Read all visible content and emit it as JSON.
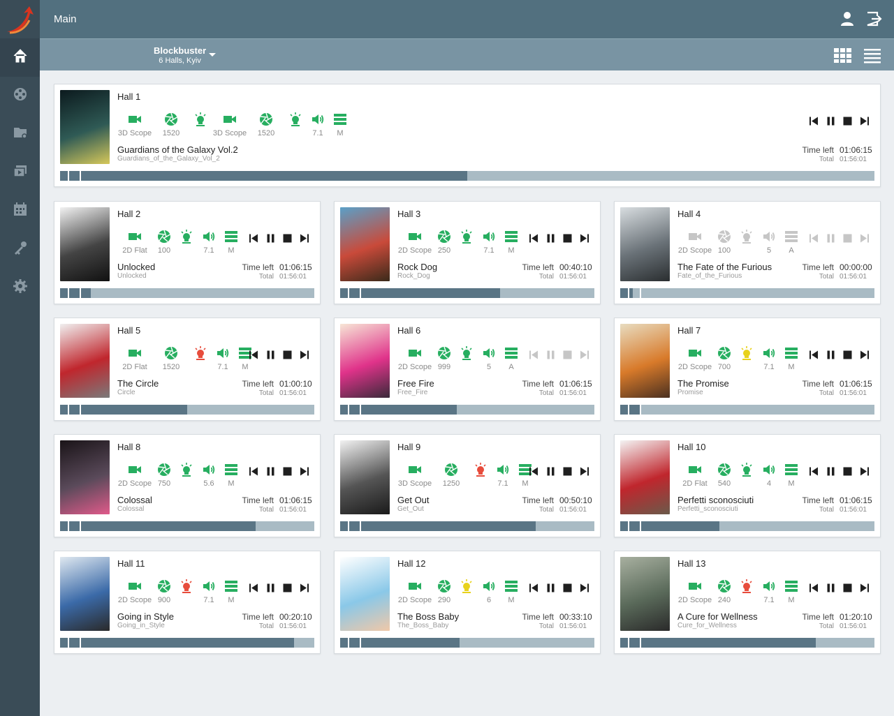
{
  "header": {
    "title": "Main"
  },
  "cinema": {
    "name": "Blockbuster",
    "location": "6 Halls, Kyiv"
  },
  "labels": {
    "time_left": "Time left",
    "total": "Total"
  },
  "colors": {
    "ok": "#27ae60",
    "warn": "#e8d21c",
    "err": "#e74c3c",
    "off": "#c6c6c6",
    "bar": "#a9bbc4",
    "fill": "#5a7585"
  },
  "nav": [
    {
      "icon": "home-icon",
      "active": true
    },
    {
      "icon": "film-reel-icon"
    },
    {
      "icon": "folder-settings-icon"
    },
    {
      "icon": "playlist-icon"
    },
    {
      "icon": "calendar-icon"
    },
    {
      "icon": "key-icon"
    },
    {
      "icon": "settings-gear-icon"
    }
  ],
  "halls": [
    {
      "name": "Hall 1",
      "movie": "Guardians of the Galaxy Vol.2",
      "file": "Guardians_of_the_Galaxy_Vol_2",
      "time_left": "01:06:15",
      "total": "01:56:01",
      "progress": 0.5,
      "active": true,
      "layout": "wide",
      "poster": [
        "#0c1a1e",
        "#2f5a55",
        "#d6c85a"
      ],
      "equip": [
        {
          "type": "projector",
          "label": "3D Scope",
          "status": "ok"
        },
        {
          "type": "lens",
          "label": "1520",
          "status": "ok"
        },
        {
          "type": "lamp",
          "label": "",
          "status": "ok"
        },
        {
          "type": "projector",
          "label": "3D Scope",
          "status": "ok"
        },
        {
          "type": "lens",
          "label": "1520",
          "status": "ok"
        },
        {
          "type": "lamp",
          "label": "",
          "status": "ok"
        },
        {
          "type": "sound",
          "label": "7.1",
          "status": "ok"
        },
        {
          "type": "list",
          "label": "M",
          "status": "ok"
        }
      ]
    },
    {
      "name": "Hall  2",
      "movie": "Unlocked",
      "file": "Unlocked",
      "time_left": "01:06:15",
      "total": "01:56:01",
      "progress": 0.12,
      "active": true,
      "poster": [
        "#f2f2f2",
        "#444",
        "#111"
      ],
      "equip": [
        {
          "type": "projector",
          "label": "2D Flat",
          "status": "ok"
        },
        {
          "type": "lens",
          "label": "100",
          "status": "ok"
        },
        {
          "type": "lamp",
          "label": "",
          "status": "ok"
        },
        {
          "type": "sound",
          "label": "7.1",
          "status": "ok"
        },
        {
          "type": "list",
          "label": "M",
          "status": "ok"
        }
      ]
    },
    {
      "name": "Hall 3",
      "movie": "Rock Dog",
      "file": "Rock_Dog",
      "time_left": "00:40:10",
      "total": "01:56:01",
      "progress": 0.63,
      "active": true,
      "poster": [
        "#5aa0c8",
        "#c94a3a",
        "#3a2a1a"
      ],
      "equip": [
        {
          "type": "projector",
          "label": "2D Scope",
          "status": "ok"
        },
        {
          "type": "lens",
          "label": "250",
          "status": "ok"
        },
        {
          "type": "lamp",
          "label": "",
          "status": "ok"
        },
        {
          "type": "sound",
          "label": "7.1",
          "status": "ok"
        },
        {
          "type": "list",
          "label": "M",
          "status": "ok"
        }
      ]
    },
    {
      "name": "Hall 4",
      "movie": "The Fate of the Furious",
      "file": "Fate_of_the_Furious",
      "time_left": "00:00:00",
      "total": "01:56:01",
      "progress": 0.05,
      "active": false,
      "poster": [
        "#d8dde0",
        "#6a7278",
        "#2a2e30"
      ],
      "equip": [
        {
          "type": "projector",
          "label": "2D Scope",
          "status": "off"
        },
        {
          "type": "lens",
          "label": "100",
          "status": "off"
        },
        {
          "type": "lamp",
          "label": "",
          "status": "off"
        },
        {
          "type": "sound",
          "label": "5",
          "status": "off"
        },
        {
          "type": "list",
          "label": "A",
          "status": "off"
        }
      ]
    },
    {
      "name": "Hall 5",
      "movie": "The Circle",
      "file": "Circle",
      "time_left": "01:00:10",
      "total": "01:56:01",
      "progress": 0.5,
      "active": true,
      "poster": [
        "#f0f0f0",
        "#c0262d",
        "#7a7a7a"
      ],
      "equip": [
        {
          "type": "projector",
          "label": "2D Flat",
          "status": "ok"
        },
        {
          "type": "lens",
          "label": "1520",
          "status": "ok"
        },
        {
          "type": "lamp",
          "label": "",
          "status": "err"
        },
        {
          "type": "sound",
          "label": "7.1",
          "status": "ok"
        },
        {
          "type": "list",
          "label": "M",
          "status": "ok"
        }
      ]
    },
    {
      "name": "Hall 6",
      "movie": "Free Fire",
      "file": "Free_Fire",
      "time_left": "01:06:15",
      "total": "01:56:01",
      "progress": 0.46,
      "active": false,
      "poster": [
        "#f7e6d6",
        "#e0338a",
        "#3a2a3a"
      ],
      "equip": [
        {
          "type": "projector",
          "label": "2D Scope",
          "status": "ok"
        },
        {
          "type": "lens",
          "label": "999",
          "status": "ok"
        },
        {
          "type": "lamp",
          "label": "",
          "status": "ok"
        },
        {
          "type": "sound",
          "label": "5",
          "status": "ok"
        },
        {
          "type": "list",
          "label": "A",
          "status": "ok"
        }
      ]
    },
    {
      "name": "Hall 7",
      "movie": "The Promise",
      "file": "Promise",
      "time_left": "01:06:15",
      "total": "01:56:01",
      "progress": 0.08,
      "active": true,
      "poster": [
        "#e8dcc0",
        "#d87a2a",
        "#4a3020"
      ],
      "equip": [
        {
          "type": "projector",
          "label": "2D Scope",
          "status": "ok"
        },
        {
          "type": "lens",
          "label": "700",
          "status": "ok"
        },
        {
          "type": "lamp",
          "label": "",
          "status": "warn"
        },
        {
          "type": "sound",
          "label": "7.1",
          "status": "ok"
        },
        {
          "type": "list",
          "label": "M",
          "status": "ok"
        }
      ]
    },
    {
      "name": "Hall 8",
      "movie": "Colossal",
      "file": "Colossal",
      "time_left": "01:06:15",
      "total": "01:56:01",
      "progress": 0.77,
      "active": true,
      "poster": [
        "#1a1418",
        "#5a4a5a",
        "#e05a8a"
      ],
      "equip": [
        {
          "type": "projector",
          "label": "2D Scope",
          "status": "ok"
        },
        {
          "type": "lens",
          "label": "750",
          "status": "ok"
        },
        {
          "type": "lamp",
          "label": "",
          "status": "ok"
        },
        {
          "type": "sound",
          "label": "5.6",
          "status": "ok"
        },
        {
          "type": "list",
          "label": "M",
          "status": "ok"
        }
      ]
    },
    {
      "name": "Hall 9",
      "movie": "Get Out",
      "file": "Get_Out",
      "time_left": "00:50:10",
      "total": "01:56:01",
      "progress": 0.77,
      "active": true,
      "poster": [
        "#f2f2f2",
        "#555",
        "#1a1a1a"
      ],
      "equip": [
        {
          "type": "projector",
          "label": "3D Scope",
          "status": "ok"
        },
        {
          "type": "lens",
          "label": "1250",
          "status": "ok"
        },
        {
          "type": "lamp",
          "label": "",
          "status": "err"
        },
        {
          "type": "sound",
          "label": "7.1",
          "status": "ok"
        },
        {
          "type": "list",
          "label": "M",
          "status": "ok"
        }
      ]
    },
    {
      "name": "Hall 10",
      "movie": "Perfetti sconosciuti",
      "file": "Perfetti_sconosciuti",
      "time_left": "01:06:15",
      "total": "01:56:01",
      "progress": 0.39,
      "active": true,
      "poster": [
        "#f4f4f4",
        "#c0262d",
        "#6a5a4a"
      ],
      "equip": [
        {
          "type": "projector",
          "label": "2D Flat",
          "status": "ok"
        },
        {
          "type": "lens",
          "label": "540",
          "status": "ok"
        },
        {
          "type": "lamp",
          "label": "",
          "status": "ok"
        },
        {
          "type": "sound",
          "label": "4",
          "status": "ok"
        },
        {
          "type": "list",
          "label": "M",
          "status": "ok"
        }
      ]
    },
    {
      "name": "Hall 11",
      "movie": "Going in Style",
      "file": "Going_in_Style",
      "time_left": "00:20:10",
      "total": "01:56:01",
      "progress": 0.92,
      "active": true,
      "poster": [
        "#dfe8f0",
        "#3b6aa8",
        "#2a2a2a"
      ],
      "equip": [
        {
          "type": "projector",
          "label": "2D Scope",
          "status": "ok"
        },
        {
          "type": "lens",
          "label": "900",
          "status": "ok"
        },
        {
          "type": "lamp",
          "label": "",
          "status": "err"
        },
        {
          "type": "sound",
          "label": "7.1",
          "status": "ok"
        },
        {
          "type": "list",
          "label": "M",
          "status": "ok"
        }
      ]
    },
    {
      "name": "Hall 12",
      "movie": "The Boss Baby",
      "file": "The_Boss_Baby",
      "time_left": "00:33:10",
      "total": "01:56:01",
      "progress": 0.47,
      "active": true,
      "poster": [
        "#ffffff",
        "#8ac8e8",
        "#f0c8a8"
      ],
      "equip": [
        {
          "type": "projector",
          "label": "2D Scope",
          "status": "ok"
        },
        {
          "type": "lens",
          "label": "290",
          "status": "ok"
        },
        {
          "type": "lamp",
          "label": "",
          "status": "warn"
        },
        {
          "type": "sound",
          "label": "6",
          "status": "ok"
        },
        {
          "type": "list",
          "label": "M",
          "status": "ok"
        }
      ]
    },
    {
      "name": "Hall 13",
      "movie": "A Cure for Wellness",
      "file": "Cure_for_Wellness",
      "time_left": "01:20:10",
      "total": "01:56:01",
      "progress": 0.77,
      "active": true,
      "poster": [
        "#a8b0a0",
        "#5a6a5a",
        "#2a2a2a"
      ],
      "equip": [
        {
          "type": "projector",
          "label": "2D Scope",
          "status": "ok"
        },
        {
          "type": "lens",
          "label": "240",
          "status": "ok"
        },
        {
          "type": "lamp",
          "label": "",
          "status": "err"
        },
        {
          "type": "sound",
          "label": "7.1",
          "status": "ok"
        },
        {
          "type": "list",
          "label": "M",
          "status": "ok"
        }
      ]
    }
  ]
}
